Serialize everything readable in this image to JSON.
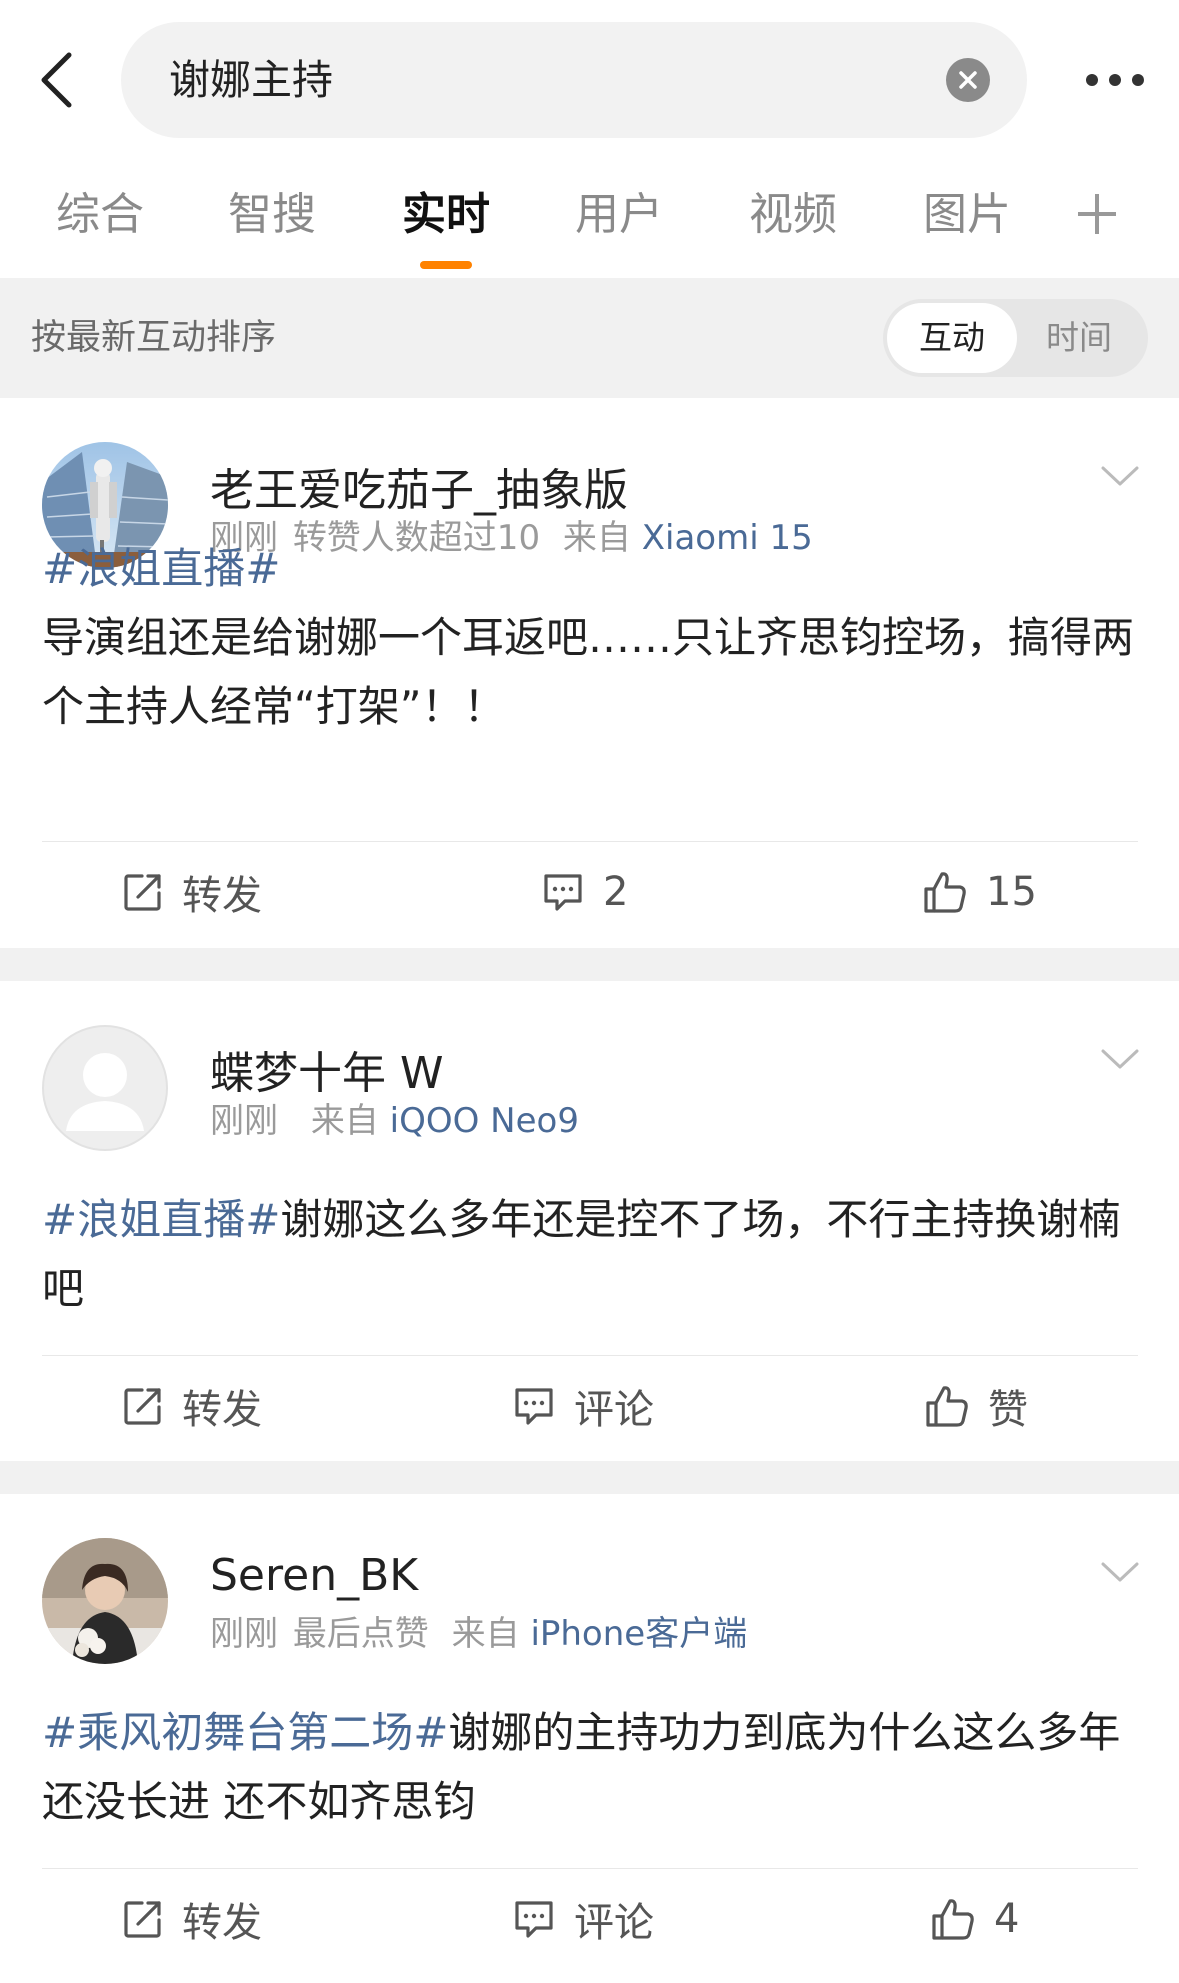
{
  "header": {
    "search_query": "谢娜主持"
  },
  "tabs": [
    {
      "label": "综合",
      "active": false
    },
    {
      "label": "智搜",
      "active": false
    },
    {
      "label": "实时",
      "active": true
    },
    {
      "label": "用户",
      "active": false
    },
    {
      "label": "视频",
      "active": false
    },
    {
      "label": "图片",
      "active": false
    }
  ],
  "sort_bar": {
    "label": "按最新互动排序",
    "options": [
      "互动",
      "时间"
    ],
    "selected": "互动"
  },
  "colors": {
    "accent": "#ff8200",
    "link": "#4a6a96",
    "separator": "#f1f1f1"
  },
  "posts": [
    {
      "username": "老王爱吃茄子_抽象版",
      "time": "刚刚",
      "extra": "转赞人数超过10",
      "source_prefix": "来自",
      "source": "Xiaomi 15",
      "hashtag": "#浪姐直播#",
      "text": "导演组还是给谢娜一个耳返吧……只让齐思钧控场，搞得两个主持人经常“打架”！！",
      "repost_label": "转发",
      "comment_label": "2",
      "like_label": "15",
      "avatar": "photo-building"
    },
    {
      "username": "蝶梦十年 W",
      "time": "刚刚",
      "extra": "",
      "source_prefix": "来自",
      "source": "iQOO Neo9",
      "hashtag": "#浪姐直播#",
      "text": "谢娜这么多年还是控不了场，不行主持换谢楠吧",
      "repost_label": "转发",
      "comment_label": "评论",
      "like_label": "赞",
      "avatar": "default-user"
    },
    {
      "username": "Seren_BK",
      "time": "刚刚",
      "extra": "最后点赞",
      "source_prefix": "来自",
      "source": "iPhone客户端",
      "hashtag": "#乘风初舞台第二场#",
      "text": "谢娜的主持功力到底为什么这么多年还没长进 还不如齐思钧",
      "repost_label": "转发",
      "comment_label": "评论",
      "like_label": "4",
      "avatar": "photo-person"
    }
  ]
}
